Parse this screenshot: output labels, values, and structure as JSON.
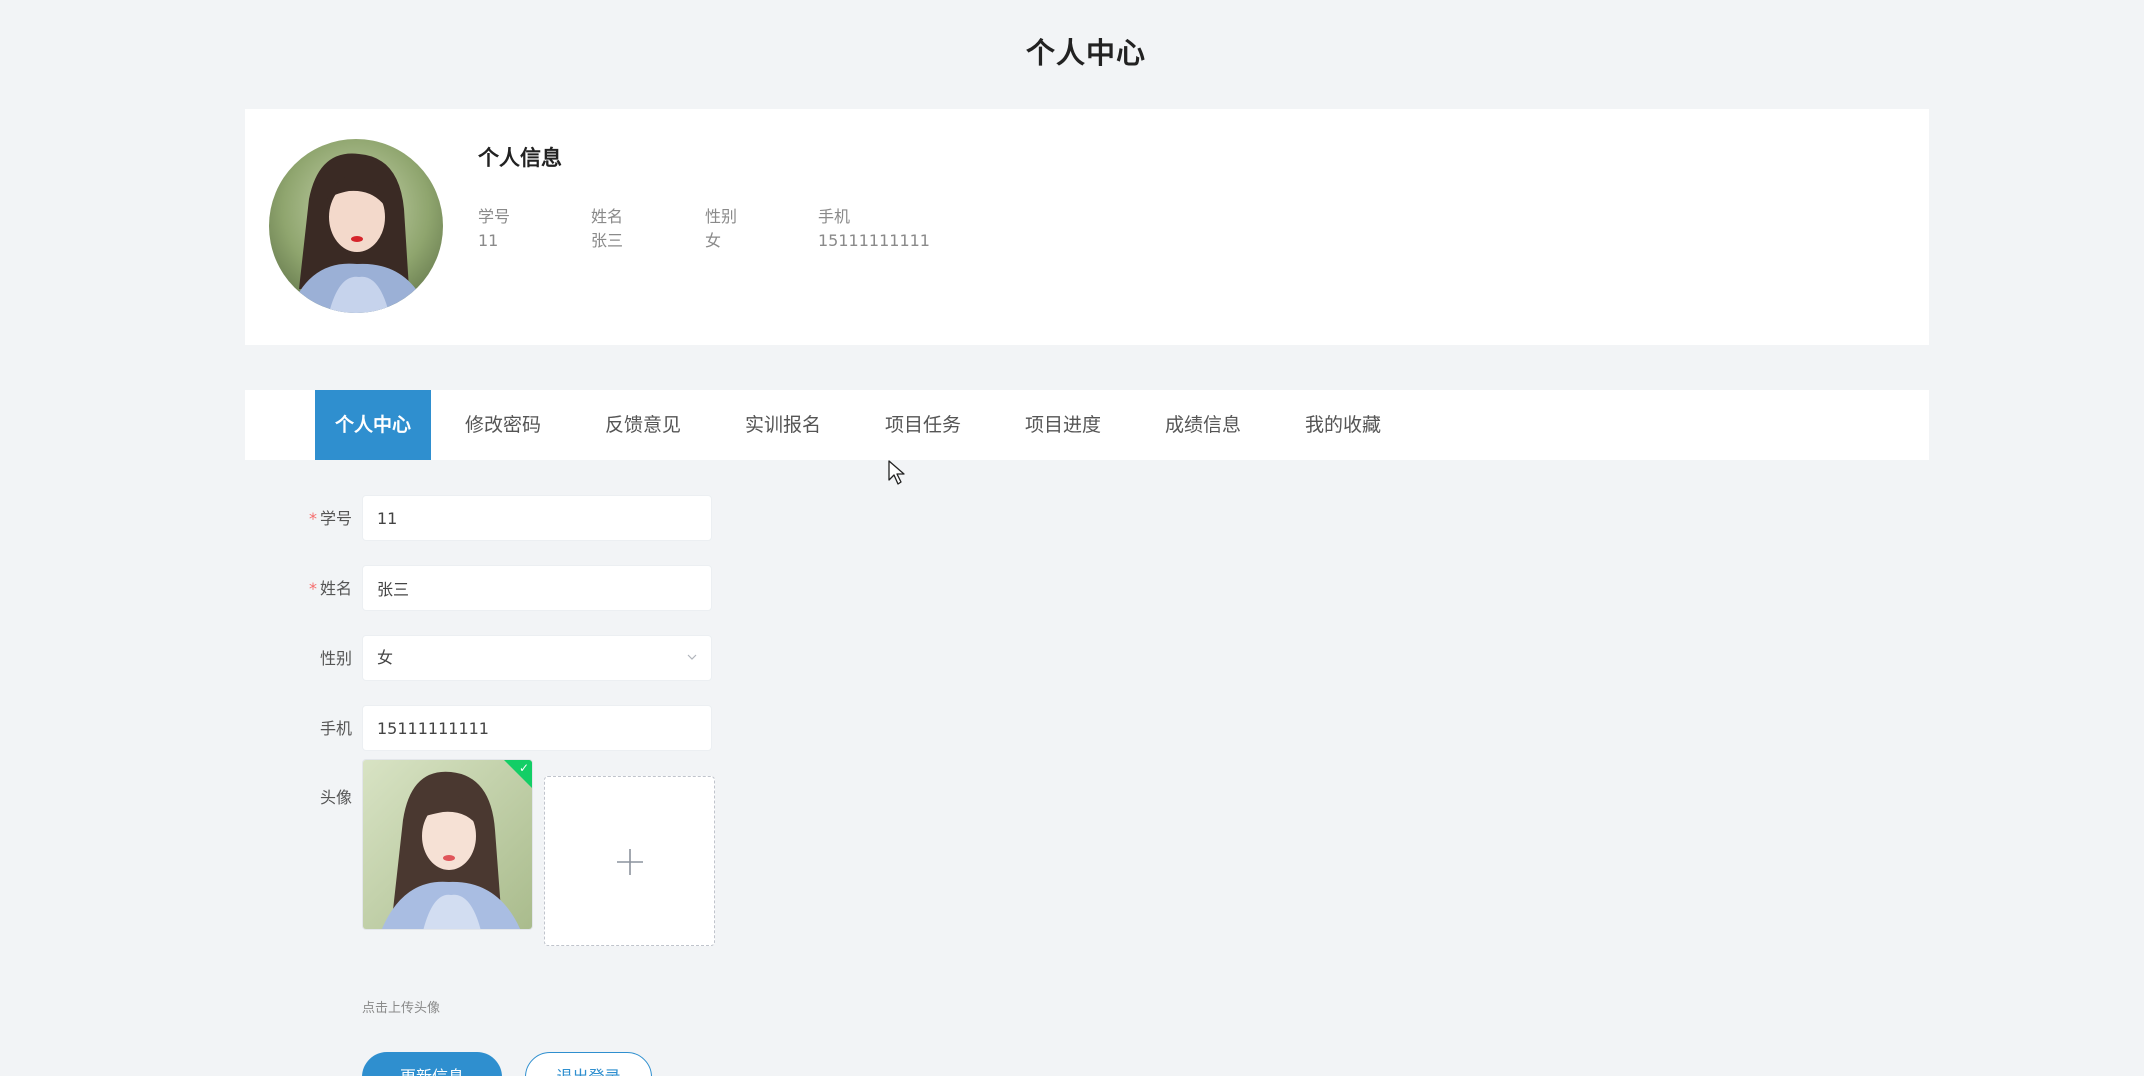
{
  "page": {
    "title": "个人中心"
  },
  "profile": {
    "section_title": "个人信息",
    "fields": [
      {
        "label": "学号",
        "value": "11"
      },
      {
        "label": "姓名",
        "value": "张三"
      },
      {
        "label": "性别",
        "value": "女"
      },
      {
        "label": "手机",
        "value": "15111111111"
      }
    ]
  },
  "tabs": [
    {
      "label": "个人中心",
      "active": true
    },
    {
      "label": "修改密码",
      "active": false
    },
    {
      "label": "反馈意见",
      "active": false
    },
    {
      "label": "实训报名",
      "active": false
    },
    {
      "label": "项目任务",
      "active": false
    },
    {
      "label": "项目进度",
      "active": false
    },
    {
      "label": "成绩信息",
      "active": false
    },
    {
      "label": "我的收藏",
      "active": false
    }
  ],
  "form": {
    "student_id": {
      "label": "学号",
      "required": true,
      "value": "11"
    },
    "name": {
      "label": "姓名",
      "required": true,
      "value": "张三"
    },
    "gender": {
      "label": "性别",
      "required": false,
      "value": "女"
    },
    "phone": {
      "label": "手机",
      "required": false,
      "value": "15111111111"
    },
    "avatar": {
      "label": "头像",
      "upload_tip": "点击上传头像"
    },
    "required_mark": "*"
  },
  "buttons": {
    "primary_label": "更新信息",
    "secondary_label": "退出登录"
  },
  "colors": {
    "accent": "#2f8fcf",
    "background": "#f2f4f6",
    "success": "#13ce66",
    "required": "#f56c6c"
  },
  "icons": {
    "select_arrow": "chevron-down-icon",
    "upload": "plus-icon",
    "uploaded": "check-icon",
    "pointer": "cursor-icon"
  }
}
